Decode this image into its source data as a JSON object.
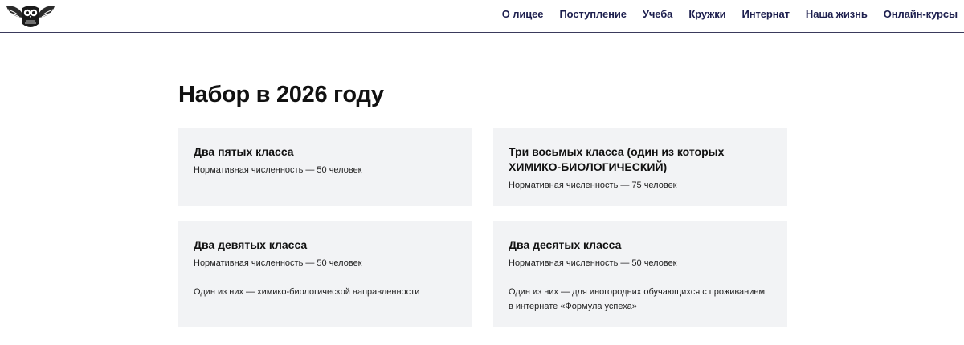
{
  "header": {
    "logo_icon": "owl-logo-icon",
    "nav": [
      {
        "label": "О лицее"
      },
      {
        "label": "Поступление"
      },
      {
        "label": "Учеба"
      },
      {
        "label": "Кружки"
      },
      {
        "label": "Интернат"
      },
      {
        "label": "Наша жизнь"
      },
      {
        "label": "Онлайн-курсы"
      }
    ]
  },
  "main": {
    "title": "Набор в 2026 году",
    "cards": [
      {
        "title": "Два пятых класса",
        "count": "Нормативная численность — 50 человек"
      },
      {
        "title_line1": "Три восьмых класса (один из которых",
        "title_line2": "ХИМИКО-БИОЛОГИЧЕСКИЙ)",
        "count": "Нормативная численность — 75 человек"
      },
      {
        "title": "Два девятых класса",
        "count": "Нормативная численность — 50 человек",
        "note": "Один из них — химико-биологической направленности"
      },
      {
        "title": "Два десятых класса",
        "count": "Нормативная численность — 50 человек",
        "note_line1": "Один из них — для иногородних обучающихся с проживанием",
        "note_line2": "в интернате «Формула успеха»"
      }
    ]
  },
  "colors": {
    "nav_text": "#1d1f4e",
    "card_bg": "#f2f3f5",
    "header_border": "#3a3a5c"
  }
}
